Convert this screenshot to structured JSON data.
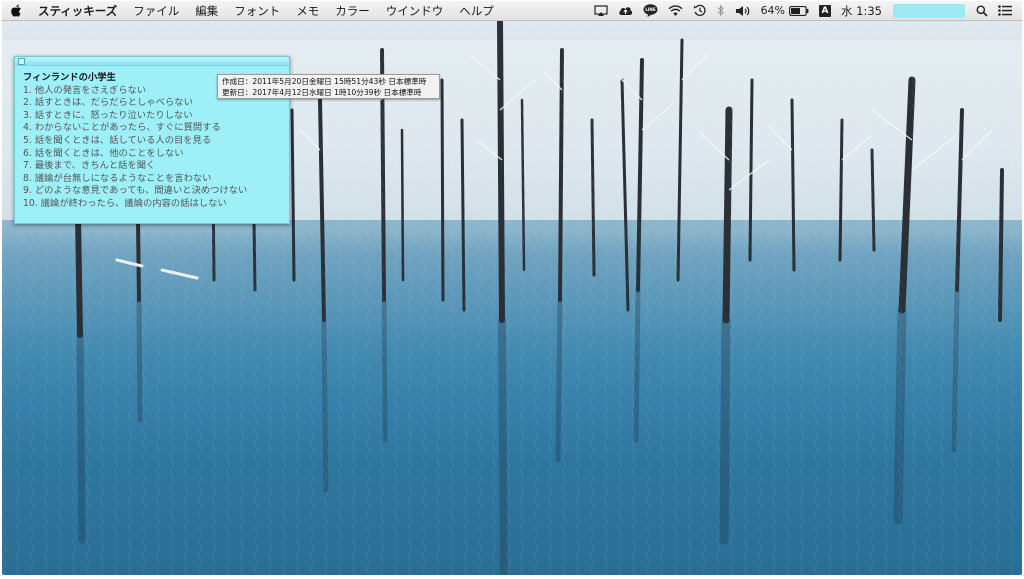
{
  "menubar": {
    "app_name": "スティッキーズ",
    "menus": [
      "ファイル",
      "編集",
      "フォント",
      "メモ",
      "カラー",
      "ウインドウ",
      "ヘルプ"
    ],
    "status": {
      "battery_percent": "64%",
      "input_source": "A",
      "clock": "水 1:35",
      "line_label": "LINE"
    },
    "icons": [
      "apple-logo",
      "airplay",
      "cloud-upload",
      "line-app",
      "wifi",
      "time-machine",
      "bluetooth",
      "volume",
      "battery",
      "input-source",
      "search",
      "notification-center"
    ]
  },
  "sticky": {
    "color": "#9ef0f8",
    "title": "フィンランドの小学生",
    "lines": [
      "1. 他人の発言をさえぎらない",
      "2. 話すときは、だらだらとしゃべらない",
      "3. 話すときに、怒ったり泣いたりしない",
      "4. わからないことがあったら、すぐに質問する",
      "5. 話を聞くときは、話している人の目を見る",
      "6. 話を聞くときは、他のことをしない",
      "7. 最後まで、きちんと話を聞く",
      "8. 議論が台無しになるようなことを言わない",
      "9. どのような意見であっても、間違いと決めつけない",
      "10. 議論が終わったら、議論の内容の話はしない"
    ]
  },
  "tooltip": {
    "created": "作成日：2011年5月20日金曜日 15時51分43秒 日本標準時",
    "modified": "更新日：2017年4月12日水曜日 1時10分39秒 日本標準時"
  }
}
